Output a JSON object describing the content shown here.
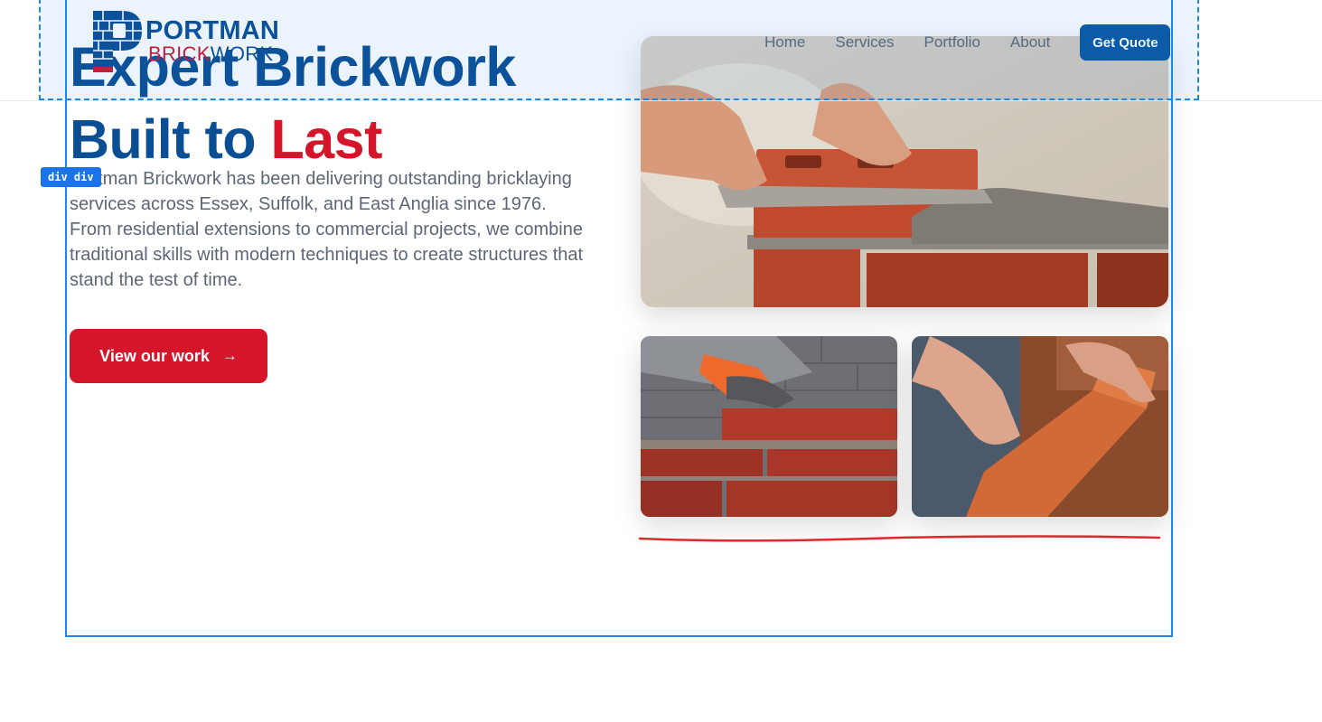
{
  "brand": {
    "name_line1": "PORTMAN",
    "name_line2_part1": "BRICK",
    "name_line2_part2": "WORK",
    "logo_icon": "brick-p-monogram-icon",
    "colors": {
      "navy": "#0a4e93",
      "red": "#d4152a",
      "button_blue": "#0a57a3",
      "text_gray": "#5d6677"
    }
  },
  "nav": {
    "items": [
      {
        "label": "Home"
      },
      {
        "label": "Services"
      },
      {
        "label": "Portfolio"
      },
      {
        "label": "About"
      }
    ],
    "cta_label": "Get Quote"
  },
  "hero": {
    "title_line1": "Expert Brickwork",
    "title_line2_part1": "Built to ",
    "title_line2_part2": "Last",
    "description": "Portman Brickwork has been delivering outstanding bricklaying services across Essex, Suffolk, and East Anglia since 1976. From residential extensions to commercial projects, we combine traditional skills with modern techniques to create structures that stand the test of time.",
    "cta_label": "View our work",
    "cta_icon": "arrow-right-icon"
  },
  "gallery": {
    "images": [
      {
        "subject": "bricklayer-trowel-mortar-photo"
      },
      {
        "subject": "gloved-hand-laying-brick-photo"
      },
      {
        "subject": "hands-placing-brick-photo"
      }
    ]
  },
  "devtools": {
    "element_tag": "div div"
  }
}
